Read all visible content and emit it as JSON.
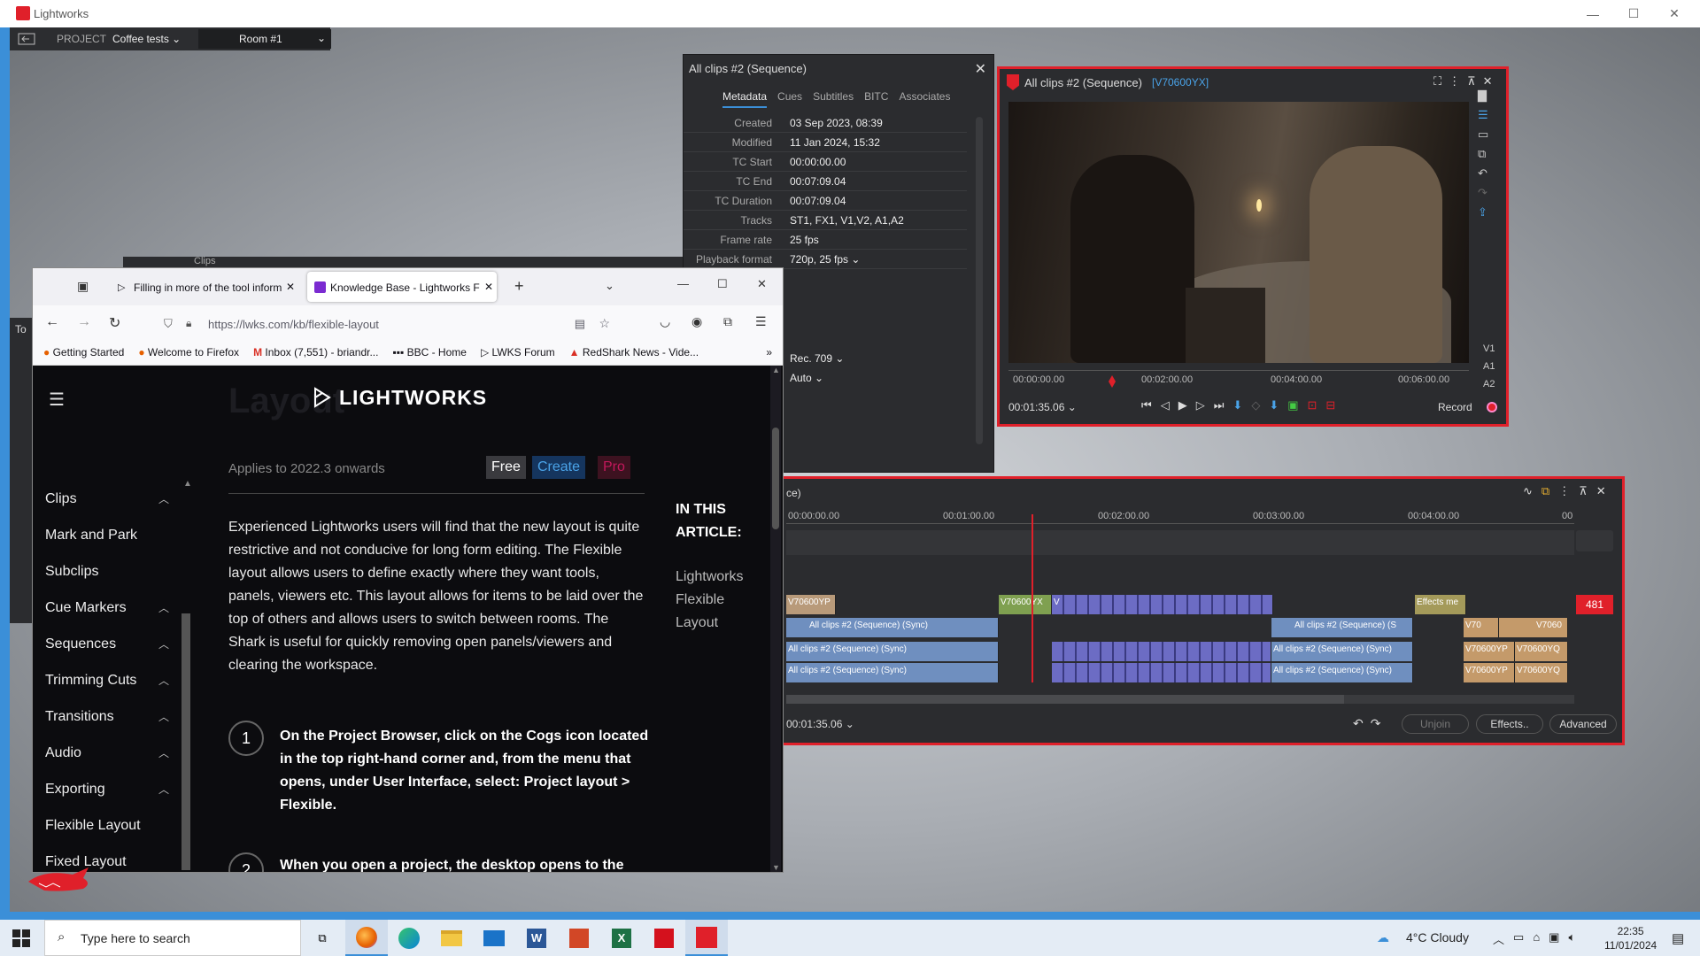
{
  "app": {
    "title": "Lightworks"
  },
  "project_bar": {
    "project_label": "PROJECT",
    "project_name": "Coffee tests",
    "room": "Room #1"
  },
  "metadata_panel": {
    "title": "All clips #2 (Sequence)",
    "tabs": [
      "Metadata",
      "Cues",
      "Subtitles",
      "BITC",
      "Associates"
    ],
    "rows": [
      {
        "key": "Created",
        "value": "03 Sep 2023, 08:39"
      },
      {
        "key": "Modified",
        "value": "11 Jan 2024, 15:32"
      },
      {
        "key": "TC Start",
        "value": "00:00:00.00"
      },
      {
        "key": "TC End",
        "value": "00:07:09.04"
      },
      {
        "key": "TC Duration",
        "value": "00:07:09.04"
      },
      {
        "key": "Tracks",
        "value": "ST1, FX1, V1,V2, A1,A2"
      },
      {
        "key": "Frame rate",
        "value": "25 fps"
      },
      {
        "key": "Playback format",
        "value": "720p, 25 fps"
      }
    ],
    "extra_values": [
      "Rec. 709",
      "Auto"
    ]
  },
  "viewer": {
    "title": "All clips #2 (Sequence)",
    "clip_id": "[V70600YX]",
    "ruler": [
      "00:00:00.00",
      "00:02:00.00",
      "00:04:00.00",
      "00:06:00.00"
    ],
    "timecode": "00:01:35.06",
    "record_label": "Record",
    "tracks": [
      "V1",
      "A1",
      "A2"
    ]
  },
  "timeline": {
    "title": "ce)",
    "ruler": [
      "00:00:00.00",
      "00:01:00.00",
      "00:02:00.00",
      "00:03:00.00",
      "00:04:00.00",
      "00"
    ],
    "count": "481",
    "timecode": "00:01:35.06",
    "clip_labels": {
      "v_a": "V70600YP",
      "v_b": "V70600YX",
      "v_short": "V",
      "effects": "Effects me",
      "sync": "All clips #2 (Sequence) (Sync)",
      "sync_cut": "All clips #2 (Sequence) (S",
      "a_p": "V70600YP",
      "a_q": "V70600YQ",
      "v70": "V70",
      "v706": "V7060"
    },
    "buttons": {
      "unjoin": "Unjoin",
      "effects": "Effects..",
      "advanced": "Advanced"
    }
  },
  "behind_window": {
    "title": "Clips"
  },
  "left_clip": {
    "text": "To"
  },
  "firefox": {
    "tabs": [
      {
        "title": "Filling in more of the tool inform"
      },
      {
        "title": "Knowledge Base - Lightworks F"
      }
    ],
    "url": "https://lwks.com/kb/flexible-layout",
    "bookmarks": [
      "Getting Started",
      "Welcome to Firefox",
      "Inbox (7,551) - briandr...",
      "BBC - Home",
      "LWKS Forum",
      "RedShark News - Vide..."
    ]
  },
  "kb": {
    "logo": "LIGHTWORKS",
    "ghost_title": "Layout",
    "applies": "Applies to 2022.3 onwards",
    "badges": {
      "free": "Free",
      "create": "Create",
      "pro": "Pro"
    },
    "nav": [
      "Clips",
      "Mark and Park",
      "Subclips",
      "Cue Markers",
      "Sequences",
      "Trimming Cuts",
      "Transitions",
      "Audio",
      "Exporting",
      "Flexible Layout",
      "Fixed Layout"
    ],
    "body": "Experienced Lightworks users will find that the new layout is quite restrictive and not conducive for long form editing. The Flexible layout allows users to define exactly where they want tools, panels, viewers etc. This layout allows for items to be laid over the top of others and allows users to switch between rooms. The Shark is useful for quickly removing open panels/viewers and clearing the workspace.",
    "step1_num": "1",
    "step1": "On the Project Browser, click on the Cogs icon located in the top right-hand corner and, from the menu that opens, under User Interface, select: Project layout > Flexible.",
    "step2_num": "2",
    "step2": "When you open a project, the desktop opens to the",
    "toc_heading": "IN THIS ARTICLE:",
    "toc": "Lightworks Flexible Layout"
  },
  "taskbar": {
    "search_placeholder": "Type here to search",
    "weather": "4°C  Cloudy",
    "time": "22:35",
    "date": "11/01/2024"
  },
  "colors": {
    "accent_red": "#e0202a",
    "brand_blue": "#3b8fd8",
    "create_blue": "#1a73c8",
    "pro_red": "#c2185b"
  }
}
